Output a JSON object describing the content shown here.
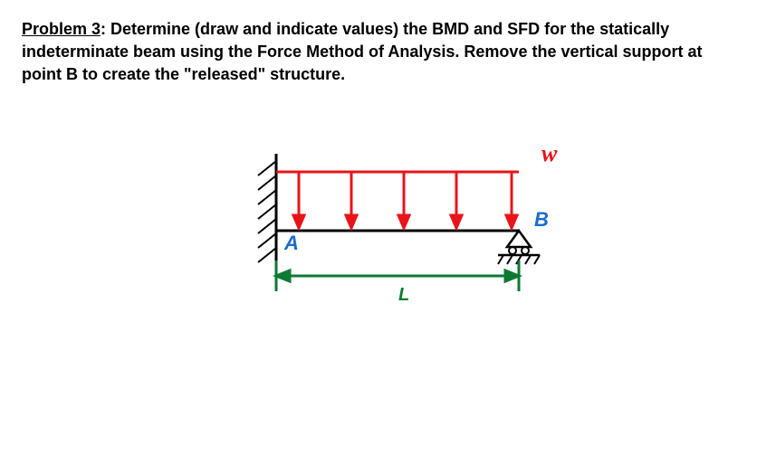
{
  "problem": {
    "label": "Problem 3",
    "text": ": Determine (draw and indicate values) the BMD and SFD for the statically indeterminate beam using the Force Method of Analysis. Remove the vertical support at point B to create the \"released\" structure."
  },
  "diagram": {
    "point_left": "A",
    "point_right": "B",
    "load_symbol": "w",
    "length_symbol": "L"
  }
}
